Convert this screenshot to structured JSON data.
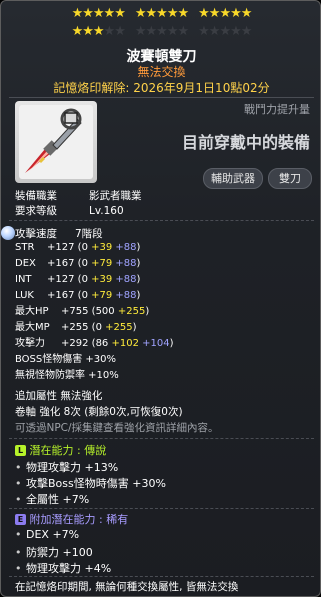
{
  "stars": {
    "filled_row1": 15,
    "total_row1": 15,
    "filled_row2": 3,
    "total_row2": 10
  },
  "item": {
    "name": "波賽頓雙刀",
    "untradable": "無法交換",
    "memory_seal": "記憶烙印解除: 2026年9月1日10點02分"
  },
  "combat_power_label": "戰鬥力提升量",
  "equipped_label": "目前穿戴中的裝備",
  "tags": [
    "輔助武器",
    "雙刀"
  ],
  "info": {
    "job_label": "裝備職業",
    "job_value": "影武者職業",
    "level_label": "要求等級",
    "level_value": "Lv.160"
  },
  "attack_speed": {
    "label": "攻擊速度",
    "value": "7階段"
  },
  "stats": [
    {
      "name": "STR",
      "total": "+127",
      "base": "0",
      "flame": "+39",
      "enhance": "+88"
    },
    {
      "name": "DEX",
      "total": "+167",
      "base": "0",
      "flame": "+79",
      "enhance": "+88"
    },
    {
      "name": "INT",
      "total": "+127",
      "base": "0",
      "flame": "+39",
      "enhance": "+88"
    },
    {
      "name": "LUK",
      "total": "+167",
      "base": "0",
      "flame": "+79",
      "enhance": "+88"
    }
  ],
  "hp": {
    "label": "最大HP",
    "total": "+755",
    "base": "500",
    "enhance": "+255"
  },
  "mp": {
    "label": "最大MP",
    "total": "+255",
    "base": "0",
    "enhance": "+255"
  },
  "atk": {
    "label": "攻擊力",
    "total": "+292",
    "base": "86",
    "flame": "+102",
    "enhance": "+104"
  },
  "boss": "BOSS怪物傷害 +30%",
  "ied": "無視怪物防禦率 +10%",
  "extra_attr": "追加屬性 無法強化",
  "scroll": "卷軸 強化 8次 (剩餘0次,可恢復0次)",
  "npc_hint": "可透過NPC/採集鍵查看強化資訊詳細內容。",
  "potential": {
    "badge": "L",
    "title": "潛在能力 : 傳說",
    "lines": [
      "物理攻擊力 +13%",
      "攻擊Boss怪物時傷害 +30%",
      "全屬性 +7%"
    ]
  },
  "additional": {
    "badge": "E",
    "title": "附加潛在能力 : 稀有",
    "lines": [
      "DEX +7%",
      "防禦力 +100",
      "物理攻擊力 +4%"
    ]
  },
  "footer": "在記憶烙印期間, 無論何種交換屬性, 皆無法交換",
  "colors": {
    "star": "#f8d82a",
    "legend": "#b6f22a",
    "rare": "#8c7cf0",
    "orange": "#ff9a3a"
  }
}
